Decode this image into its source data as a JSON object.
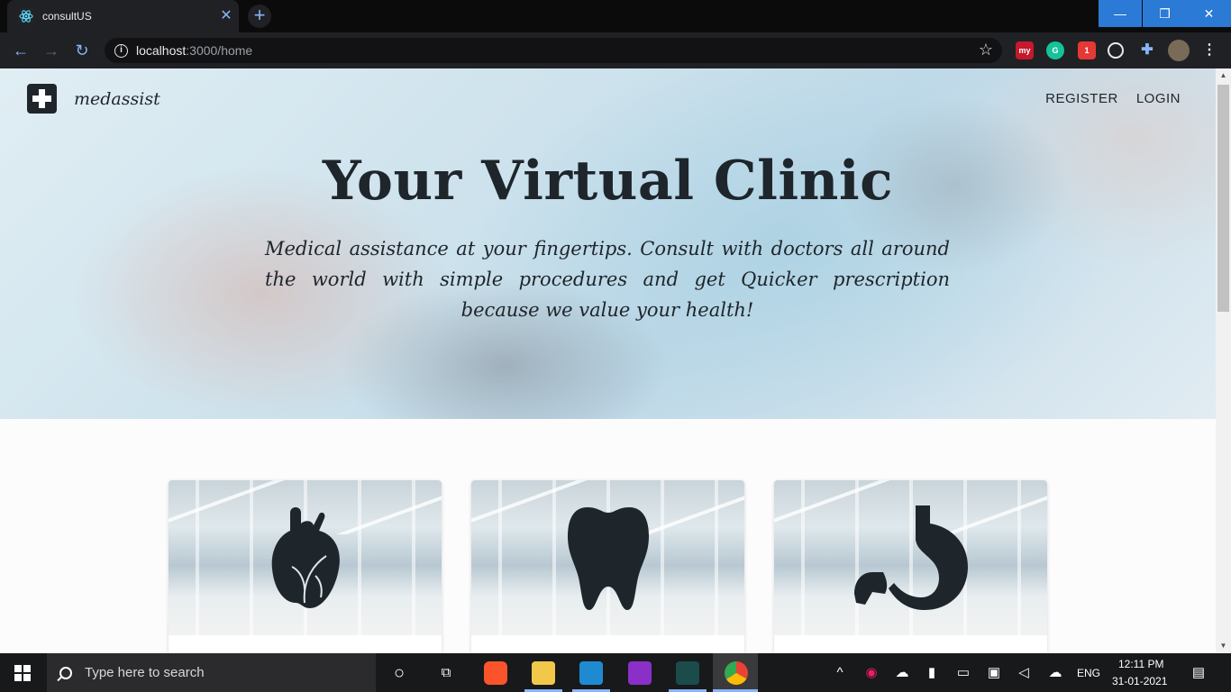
{
  "browser": {
    "tab_title": "consultUS",
    "tab_close": "✕",
    "new_tab": "+",
    "url_host": "localhost",
    "url_path": ":3000/home",
    "window_minimize": "—",
    "window_restore": "❐",
    "window_close": "✕"
  },
  "extensions": [
    "my",
    "G",
    "1"
  ],
  "site": {
    "brand_name": "medassist",
    "nav": {
      "register": "REGISTER",
      "login": "LOGIN"
    },
    "hero": {
      "title": "Your Virtual Clinic",
      "subtitle": "Medical assistance at your fingertips. Consult with doctors all around the world with simple procedures and get Quicker prescription because we value your health!"
    },
    "cards": [
      {
        "icon": "heart-icon"
      },
      {
        "icon": "tooth-icon"
      },
      {
        "icon": "stomach-icon"
      }
    ]
  },
  "taskbar": {
    "search_placeholder": "Type here to search",
    "language": "ENG",
    "time": "12:11 PM",
    "date": "31-01-2021"
  },
  "colors": {
    "chrome_bg": "#202124",
    "accent_blue": "#8ab4f8",
    "window_controls": "#2a7ad6",
    "ink": "#1e252b"
  }
}
